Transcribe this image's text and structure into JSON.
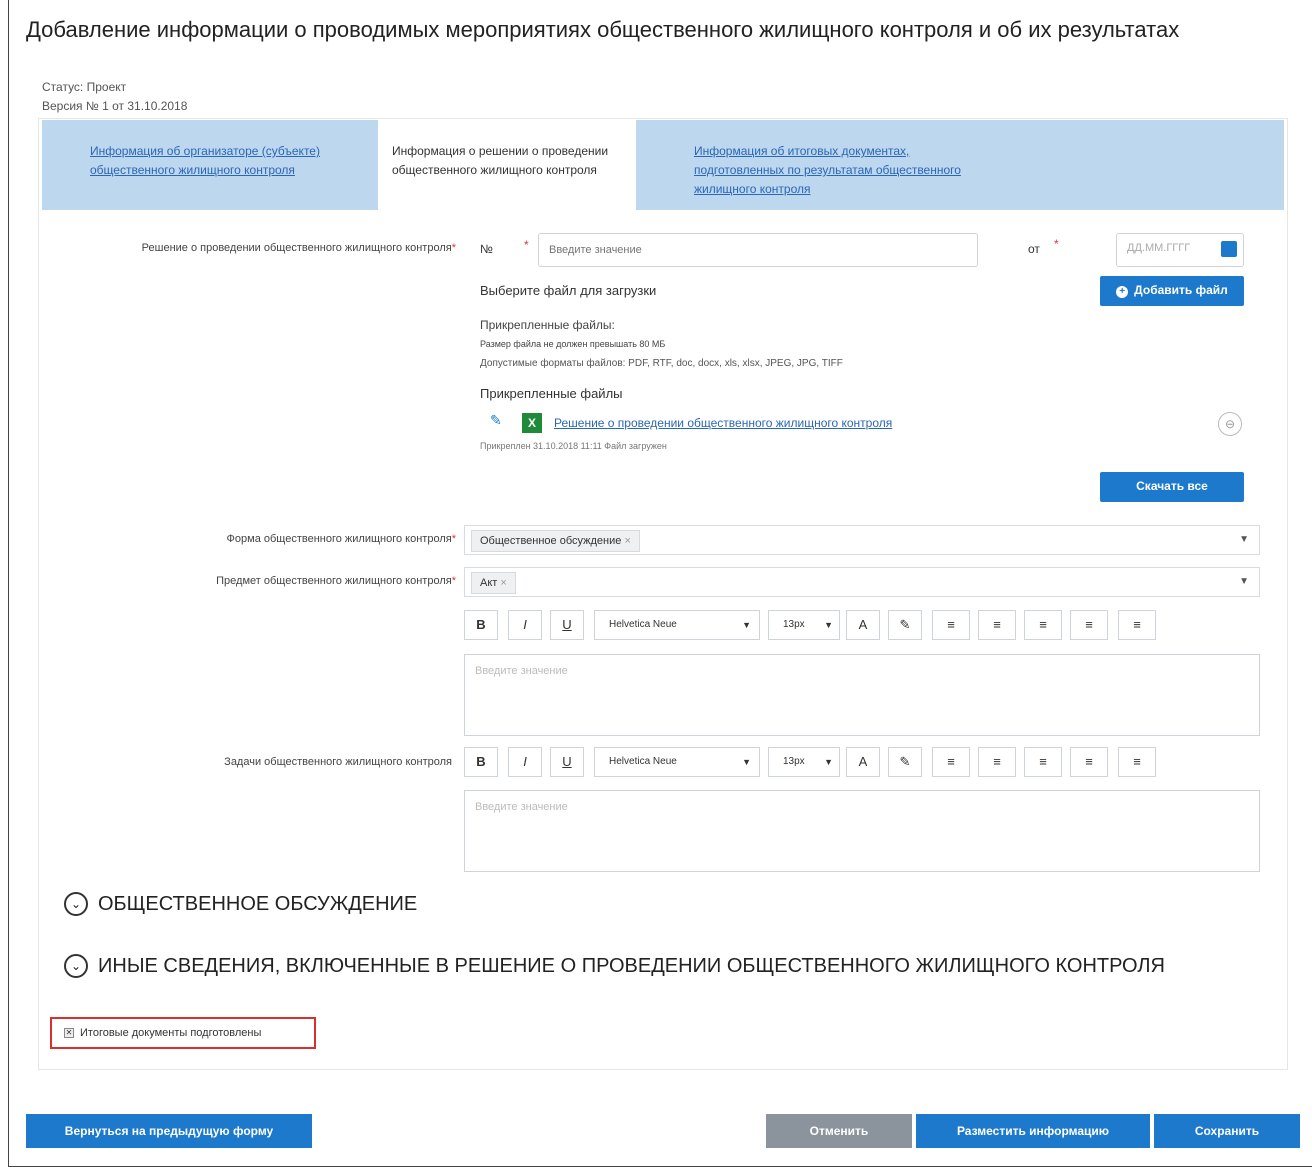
{
  "page": {
    "title": "Добавление информации о проводимых мероприятиях общественного жилищного контроля и об их результатах",
    "status": "Статус: Проект",
    "version": "Версия № 1 от 31.10.2018"
  },
  "tabs": [
    {
      "label": "Информация об организаторе (субъекте) общественного жилищного контроля"
    },
    {
      "label": "Информация о решении о проведении общественного жилищного контроля"
    },
    {
      "label": "Информация об итоговых документах, подготовленных по результатам общественного жилищного контроля"
    }
  ],
  "decision": {
    "label": "Решение о проведении общественного жилищного контроля",
    "number_label": "№",
    "number_placeholder": "Введите значение",
    "date_label": "от",
    "date_placeholder": "ДД.ММ.ГГГГ",
    "choose_file": "Выберите файл для загрузки",
    "add_file_button": "Добавить файл",
    "attached_title": "Прикрепленные файлы:",
    "max_size": "Размер файла не должен превышать 80 МБ",
    "formats": "Допустимые форматы файлов: PDF, RTF, doc, docx, xls, xlsx, JPEG, JPG, TIFF",
    "attached_files_heading": "Прикрепленные файлы",
    "file_name": "Решение о проведении общественного жилищного контроля",
    "file_meta": "Прикреплен 31.10.2018 11:11  Файл загружен",
    "download_all": "Скачать все"
  },
  "form_field": {
    "label": "Форма общественного жилищного контроля",
    "value": "Общественное обсуждение"
  },
  "subject_field": {
    "label": "Предмет общественного жилищного контроля",
    "value": "Акт"
  },
  "editor_toolbar": {
    "bold": "B",
    "italic": "I",
    "underline": "U",
    "font": "Helvetica Neue",
    "size": "13px",
    "color": "A",
    "brush": "✎"
  },
  "editor1": {
    "placeholder": "Введите значение"
  },
  "tasks_field": {
    "label": "Задачи общественного жилищного контроля",
    "placeholder": "Введите значение"
  },
  "sections": [
    {
      "label": "ОБЩЕСТВЕННОЕ ОБСУЖДЕНИЕ"
    },
    {
      "label": "ИНЫЕ СВЕДЕНИЯ, ВКЛЮЧЕННЫЕ В РЕШЕНИЕ О ПРОВЕДЕНИИ ОБЩЕСТВЕННОГО ЖИЛИЩНОГО КОНТРОЛЯ"
    }
  ],
  "checkbox": {
    "label": "Итоговые документы подготовлены"
  },
  "footer": {
    "back": "Вернуться на предыдущую форму",
    "cancel": "Отменить",
    "publish": "Разместить информацию",
    "save": "Сохранить"
  },
  "colors": {
    "primary": "#1d79cc",
    "tab_bg": "#bcd7ee",
    "cancel": "#8b949c",
    "highlight": "#d9302c"
  }
}
